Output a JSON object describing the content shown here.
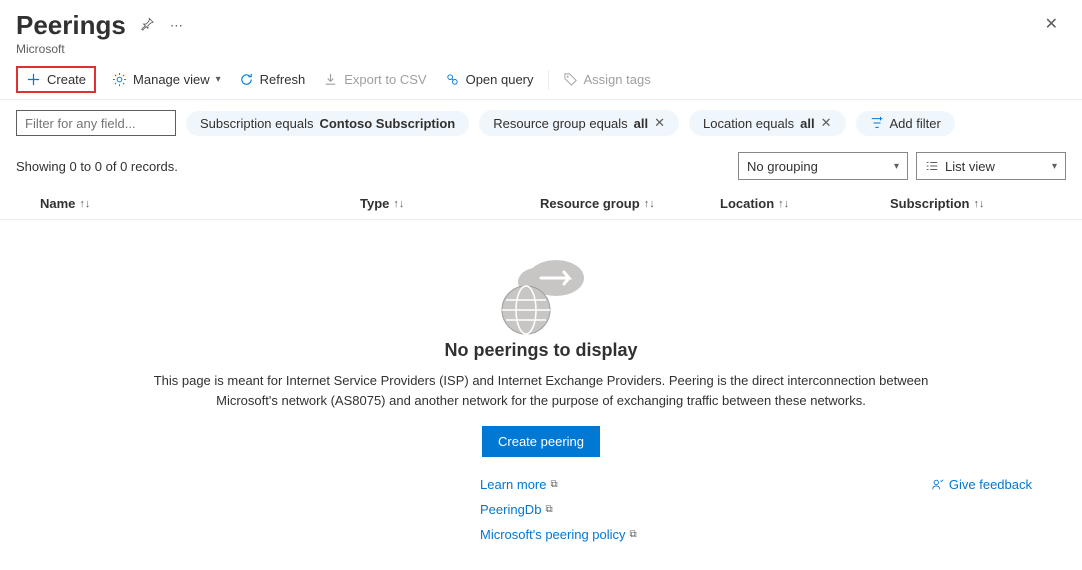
{
  "header": {
    "title": "Peerings",
    "subtitle": "Microsoft"
  },
  "toolbar": {
    "create": "Create",
    "manage_view": "Manage view",
    "refresh": "Refresh",
    "export_csv": "Export to CSV",
    "open_query": "Open query",
    "assign_tags": "Assign tags"
  },
  "filters": {
    "input_placeholder": "Filter for any field...",
    "subscription_prefix": "Subscription equals ",
    "subscription_value": "Contoso Subscription",
    "rg_prefix": "Resource group equals ",
    "rg_value": "all",
    "location_prefix": "Location equals ",
    "location_value": "all",
    "add_filter": "Add filter"
  },
  "status": {
    "records": "Showing 0 to 0 of 0 records.",
    "grouping": "No grouping",
    "view": "List view"
  },
  "columns": {
    "name": "Name",
    "type": "Type",
    "rg": "Resource group",
    "location": "Location",
    "subscription": "Subscription"
  },
  "empty": {
    "title": "No peerings to display",
    "text": "This page is meant for Internet Service Providers (ISP) and Internet Exchange Providers. Peering is the direct interconnection between Microsoft's network (AS8075) and another network for the purpose of exchanging traffic between these networks.",
    "button": "Create peering",
    "links": {
      "learn_more": "Learn more",
      "peeringdb": "PeeringDb",
      "policy": "Microsoft's peering policy"
    },
    "feedback": "Give feedback"
  }
}
